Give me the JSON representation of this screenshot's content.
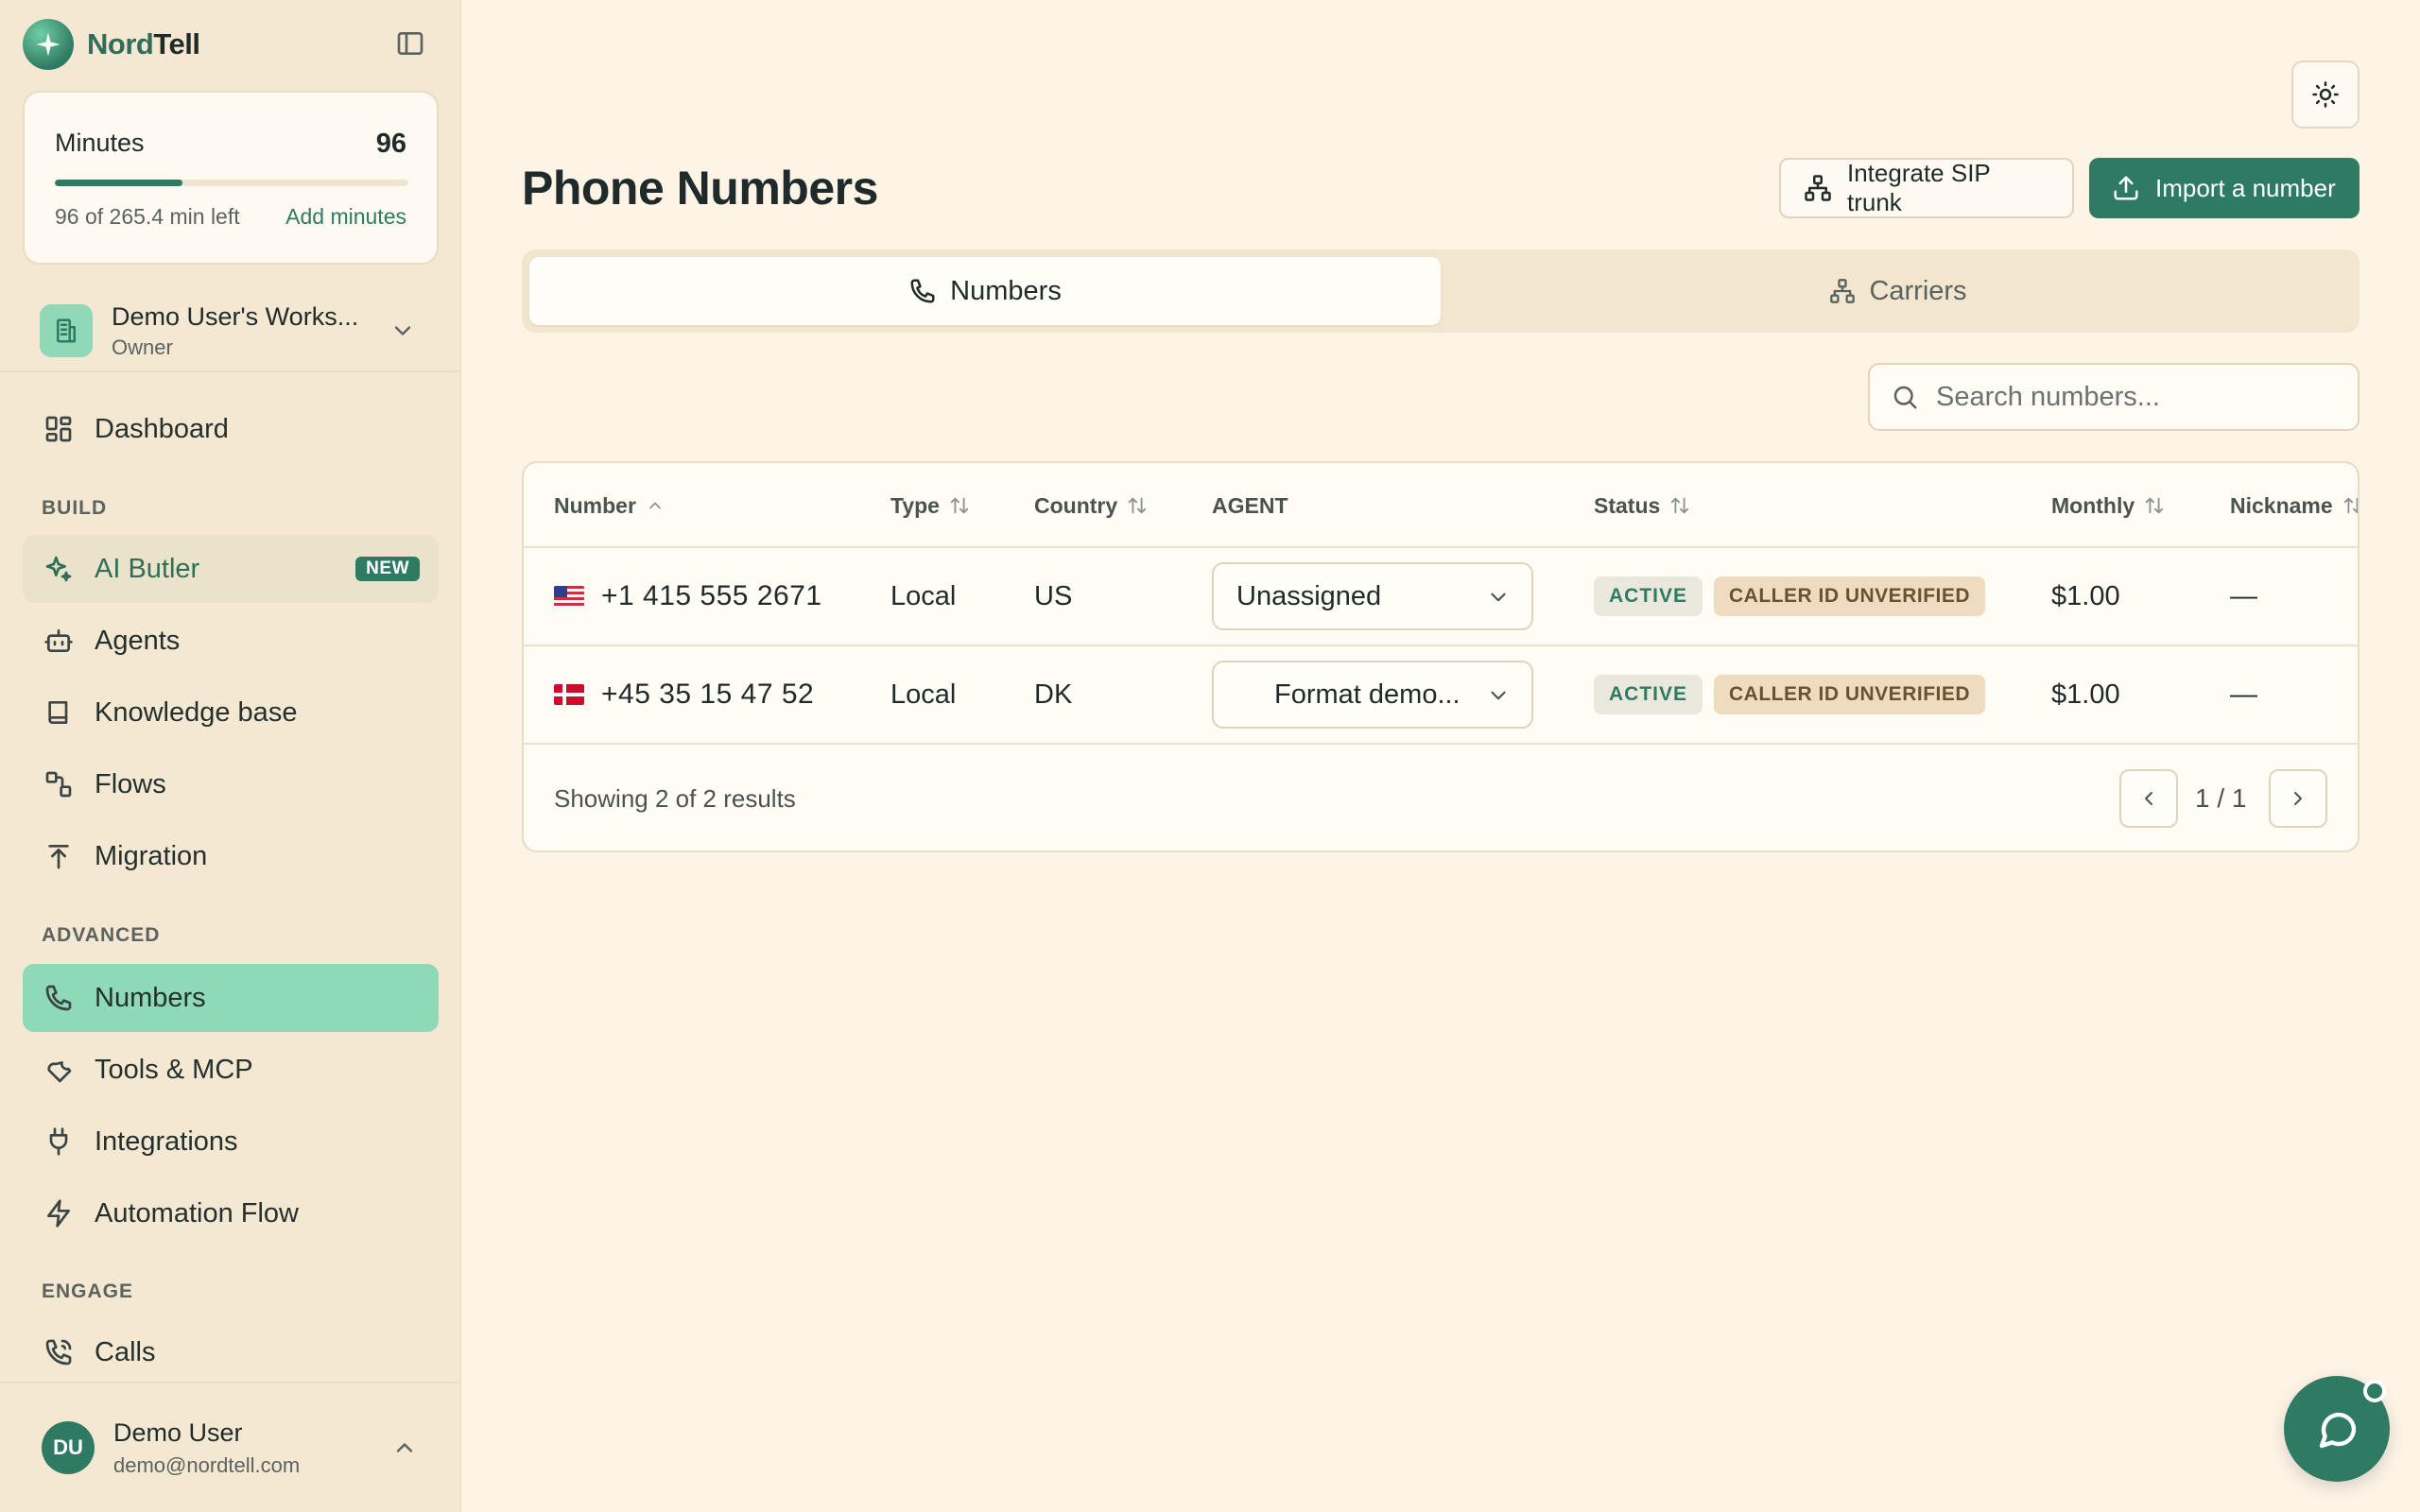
{
  "brand": {
    "name_prefix": "Nord",
    "name_suffix": "Tell"
  },
  "minutes": {
    "label": "Minutes",
    "value": "96",
    "remaining_text": "96 of 265.4 min left",
    "add_label": "Add minutes",
    "progress_fraction": 0.362
  },
  "workspace": {
    "name": "Demo User's Works...",
    "role": "Owner"
  },
  "nav": {
    "dashboard": "Dashboard",
    "build_label": "BUILD",
    "ai_butler": "AI Butler",
    "new_badge": "NEW",
    "agents": "Agents",
    "knowledge_base": "Knowledge base",
    "flows": "Flows",
    "migration": "Migration",
    "advanced_label": "ADVANCED",
    "numbers": "Numbers",
    "tools_mcp": "Tools & MCP",
    "integrations": "Integrations",
    "automation_flow": "Automation Flow",
    "engage_label": "ENGAGE",
    "calls": "Calls"
  },
  "user": {
    "initials": "DU",
    "name": "Demo User",
    "email": "demo@nordtell.com"
  },
  "page": {
    "title": "Phone Numbers",
    "integrate_label": "Integrate SIP trunk",
    "import_label": "Import a number"
  },
  "tabs": {
    "numbers": "Numbers",
    "carriers": "Carriers"
  },
  "search": {
    "placeholder": "Search numbers...",
    "value": ""
  },
  "table": {
    "headers": {
      "number": "Number",
      "type": "Type",
      "country": "Country",
      "agent": "AGENT",
      "status": "Status",
      "monthly": "Monthly",
      "nickname": "Nickname"
    },
    "rows": [
      {
        "flag": "us-flag",
        "number": "+1 415 555 2671",
        "type": "Local",
        "country": "US",
        "agent": "Unassigned",
        "status": "ACTIVE",
        "caller_id": "CALLER ID UNVERIFIED",
        "monthly": "$1.00",
        "nickname": "—"
      },
      {
        "flag": "dk-flag",
        "number": "+45 35 15 47 52",
        "type": "Local",
        "country": "DK",
        "agent": "Format demo...",
        "status": "ACTIVE",
        "caller_id": "CALLER ID UNVERIFIED",
        "monthly": "$1.00",
        "nickname": "—"
      }
    ],
    "showing": "Showing 2 of 2 results",
    "page_indicator": "1 / 1"
  },
  "colors": {
    "accent": "#2f7a62",
    "nav_active": "#8ed9b8",
    "background": "#fdf4e6",
    "sidebar": "#f5e8d2"
  }
}
